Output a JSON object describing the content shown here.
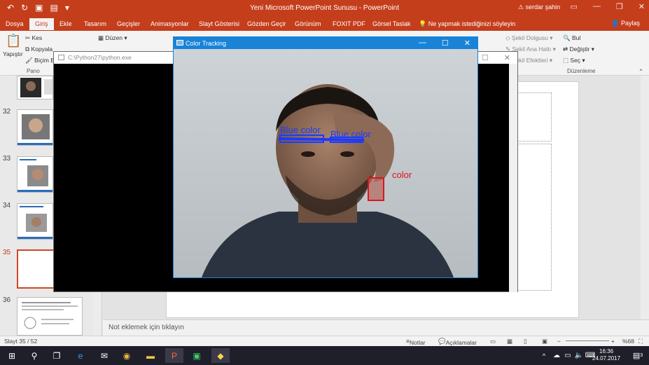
{
  "powerpoint": {
    "title": "Yeni Microsoft PowerPoint Sunusu - PowerPoint",
    "user": "serdar şahin",
    "tabs": [
      "Dosya",
      "Giriş",
      "Ekle",
      "Tasarım",
      "Geçişler",
      "Animasyonlar",
      "Slayt Gösterisi",
      "Gözden Geçir",
      "Görünüm",
      "FOXIT PDF",
      "Görsel Taslak"
    ],
    "tell_me": "Ne yapmak istediğinizi söyleyin",
    "share": "Paylaş",
    "ribbon": {
      "paste": "Yapıştır",
      "cut": "Kes",
      "copy": "Kopyala",
      "format_painter": "Biçim Bo",
      "pano": "Pano",
      "layout": "Düzen",
      "shape_fill": "Şekil Dolgusu",
      "shape_outline": "Şekil Ana Hattı",
      "shape_effects": "Şekil Efektleri",
      "find": "Bul",
      "replace": "Değiştir",
      "select": "Seç",
      "editing": "Düzenleme"
    },
    "slide_numbers": [
      "32",
      "33",
      "34",
      "35",
      "36"
    ],
    "notes_placeholder": "Not eklemek için tıklayın",
    "status": {
      "slide_count": "Slayt 35 / 52",
      "notes": "Notlar",
      "comments": "Açıklamalar",
      "zoom": "%68"
    }
  },
  "console": {
    "title": "C:\\Python27\\python.exe"
  },
  "tracking_window": {
    "title": "Color Tracking",
    "labels": {
      "blue": "Blue color",
      "blue2": "Blue color",
      "red": "color"
    },
    "colors": {
      "blue": "#1a3aff",
      "red": "#e0141e"
    }
  },
  "taskbar": {
    "time": "16:36",
    "date": "24.07.2017",
    "notifications": "3"
  }
}
